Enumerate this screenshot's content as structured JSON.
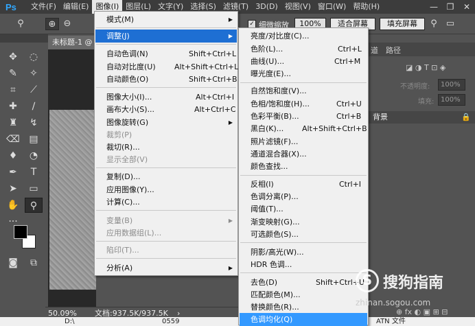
{
  "app": {
    "logo": "Ps"
  },
  "menubar": {
    "items": [
      "文件(F)",
      "编辑(E)",
      "图像(I)",
      "图层(L)",
      "文字(Y)",
      "选择(S)",
      "滤镜(T)",
      "3D(D)",
      "视图(V)",
      "窗口(W)",
      "帮助(H)"
    ],
    "active_index": 2
  },
  "window_controls": {
    "minimize": "—",
    "restore": "❐",
    "close": "✕"
  },
  "optionsbar": {
    "scrubby_zoom_label": "细微缩放",
    "zoom_value": "100%",
    "fit_screen": "适合屏幕",
    "fill_screen": "填充屏幕"
  },
  "document": {
    "tab_title": "未标题-1 @",
    "status_zoom": "50.09%",
    "status_doc": "文档:937.5K/937.5K"
  },
  "panels": {
    "tab_channels": "道",
    "tab_paths": "路径",
    "opacity_label": "不透明度:",
    "opacity_value": "100%",
    "fill_label": "填充:",
    "fill_value": "100%",
    "layer_name": "背景"
  },
  "taskbar": {
    "item1": "0559",
    "item2": "ATN 文件",
    "item3": "D:\\"
  },
  "image_menu": {
    "items": [
      {
        "label": "模式(M)",
        "shortcut": "",
        "arrow": true,
        "disabled": false
      },
      {
        "label": "调整(J)",
        "shortcut": "",
        "arrow": true,
        "disabled": false,
        "highlighted": true
      },
      {
        "label": "自动色调(N)",
        "shortcut": "Shift+Ctrl+L"
      },
      {
        "label": "自动对比度(U)",
        "shortcut": "Alt+Shift+Ctrl+L"
      },
      {
        "label": "自动颜色(O)",
        "shortcut": "Shift+Ctrl+B"
      },
      {
        "label": "图像大小(I)...",
        "shortcut": "Alt+Ctrl+I"
      },
      {
        "label": "画布大小(S)...",
        "shortcut": "Alt+Ctrl+C"
      },
      {
        "label": "图像旋转(G)",
        "shortcut": "",
        "arrow": true
      },
      {
        "label": "裁剪(P)",
        "shortcut": "",
        "disabled": true
      },
      {
        "label": "裁切(R)...",
        "shortcut": ""
      },
      {
        "label": "显示全部(V)",
        "shortcut": "",
        "disabled": true
      },
      {
        "label": "复制(D)...",
        "shortcut": ""
      },
      {
        "label": "应用图像(Y)...",
        "shortcut": ""
      },
      {
        "label": "计算(C)...",
        "shortcut": ""
      },
      {
        "label": "变量(B)",
        "shortcut": "",
        "arrow": true,
        "disabled": true
      },
      {
        "label": "应用数据组(L)...",
        "shortcut": "",
        "disabled": true
      },
      {
        "label": "陷印(T)...",
        "shortcut": "",
        "disabled": true
      },
      {
        "label": "分析(A)",
        "shortcut": "",
        "arrow": true
      }
    ]
  },
  "adjust_menu": {
    "items": [
      {
        "label": "亮度/对比度(C)...",
        "shortcut": ""
      },
      {
        "label": "色阶(L)...",
        "shortcut": "Ctrl+L"
      },
      {
        "label": "曲线(U)...",
        "shortcut": "Ctrl+M"
      },
      {
        "label": "曝光度(E)...",
        "shortcut": ""
      },
      {
        "label": "自然饱和度(V)...",
        "shortcut": ""
      },
      {
        "label": "色相/饱和度(H)...",
        "shortcut": "Ctrl+U"
      },
      {
        "label": "色彩平衡(B)...",
        "shortcut": "Ctrl+B"
      },
      {
        "label": "黑白(K)...",
        "shortcut": "Alt+Shift+Ctrl+B"
      },
      {
        "label": "照片滤镜(F)...",
        "shortcut": ""
      },
      {
        "label": "通道混合器(X)...",
        "shortcut": ""
      },
      {
        "label": "颜色查找...",
        "shortcut": ""
      },
      {
        "label": "反相(I)",
        "shortcut": "Ctrl+I"
      },
      {
        "label": "色调分离(P)...",
        "shortcut": ""
      },
      {
        "label": "阈值(T)...",
        "shortcut": ""
      },
      {
        "label": "渐变映射(G)...",
        "shortcut": ""
      },
      {
        "label": "可选颜色(S)...",
        "shortcut": ""
      },
      {
        "label": "阴影/高光(W)...",
        "shortcut": ""
      },
      {
        "label": "HDR 色调...",
        "shortcut": ""
      },
      {
        "label": "去色(D)",
        "shortcut": "Shift+Ctrl+U"
      },
      {
        "label": "匹配颜色(M)...",
        "shortcut": ""
      },
      {
        "label": "替换颜色(R)...",
        "shortcut": ""
      },
      {
        "label": "色调均化(Q)",
        "shortcut": "",
        "highlighted": true
      }
    ]
  },
  "watermark": {
    "logo_char": "S",
    "text": "搜狗指南",
    "url": "zhinan.sogou.com"
  },
  "colors": {
    "highlight": "#3399ff",
    "menu_bg": "#f0f0f0",
    "ui_bg": "#535353"
  }
}
